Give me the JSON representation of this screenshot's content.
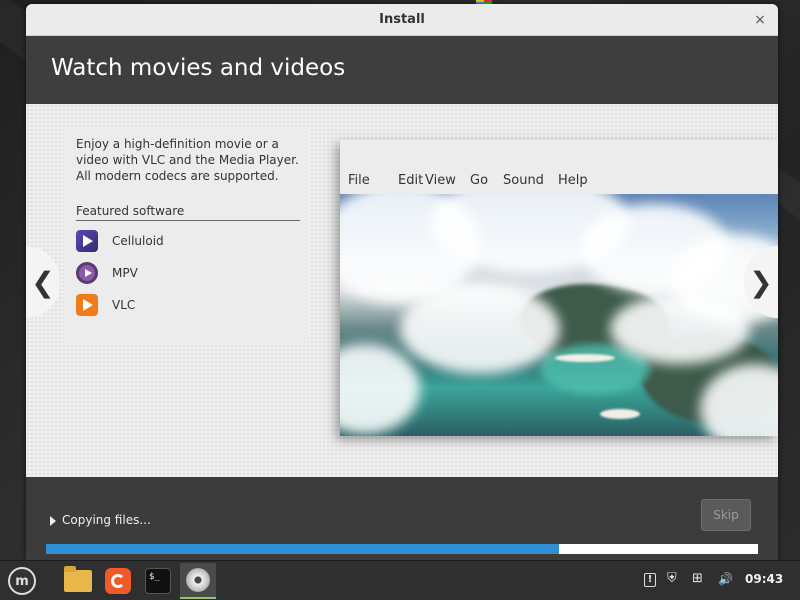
{
  "window": {
    "title": "Install",
    "close_icon": "×"
  },
  "slide": {
    "heading": "Watch movies and videos",
    "description": "Enjoy a high-definition movie or a video with VLC and the Media Player. All modern codecs are supported.",
    "featured_title": "Featured software",
    "apps": [
      {
        "label": "Celluloid",
        "icon": "celluloid-icon"
      },
      {
        "label": "MPV",
        "icon": "mpv-icon"
      },
      {
        "label": "VLC",
        "icon": "vlc-icon"
      }
    ],
    "prev_arrow": "❮",
    "next_arrow": "❯"
  },
  "player_menu": [
    "File",
    "Edit",
    "View",
    "Go",
    "Sound",
    "Help"
  ],
  "footer": {
    "status": "Copying files...",
    "skip_label": "Skip",
    "progress_fraction": 0.72
  },
  "taskbar": {
    "apps": [
      "mint-menu-icon",
      "files-icon",
      "firefox-icon",
      "terminal-icon",
      "disc-installer-icon"
    ],
    "terminal_glyph": "$_",
    "mint_glyph": "m",
    "tray": [
      "update-shield-icon",
      "security-shield-icon",
      "network-icon",
      "volume-icon"
    ],
    "tray_glyphs": {
      "update": "!",
      "security": "⛨",
      "network": "⊞",
      "volume": "🔊"
    },
    "clock": "09:43"
  },
  "colors": {
    "accent_progress": "#2e8fd3",
    "header_bg": "#3e3e3e"
  }
}
